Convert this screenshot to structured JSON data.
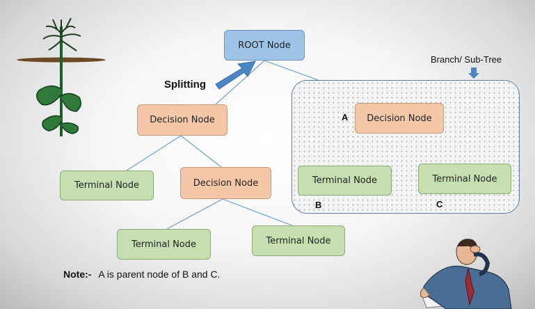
{
  "nodes": {
    "root": "ROOT Node",
    "decision_left": "Decision Node",
    "decision_mid": "Decision Node",
    "decision_right": "Decision Node",
    "terminal_left": "Terminal Node",
    "terminal_bottom_left": "Terminal Node",
    "terminal_bottom_right": "Terminal Node",
    "terminal_b": "Terminal Node",
    "terminal_c": "Terminal Node"
  },
  "labels": {
    "splitting": "Splitting",
    "branch": "Branch/ Sub-Tree",
    "a": "A",
    "b": "B",
    "c": "C"
  },
  "note": {
    "prefix": "Note:-",
    "text": "A is parent node of B and C."
  },
  "colors": {
    "root": "#9dc3e6",
    "decision": "#f4c7a8",
    "terminal": "#c5dfb1",
    "arrow": "#4a86c5",
    "connector": "#6fa0d0"
  }
}
